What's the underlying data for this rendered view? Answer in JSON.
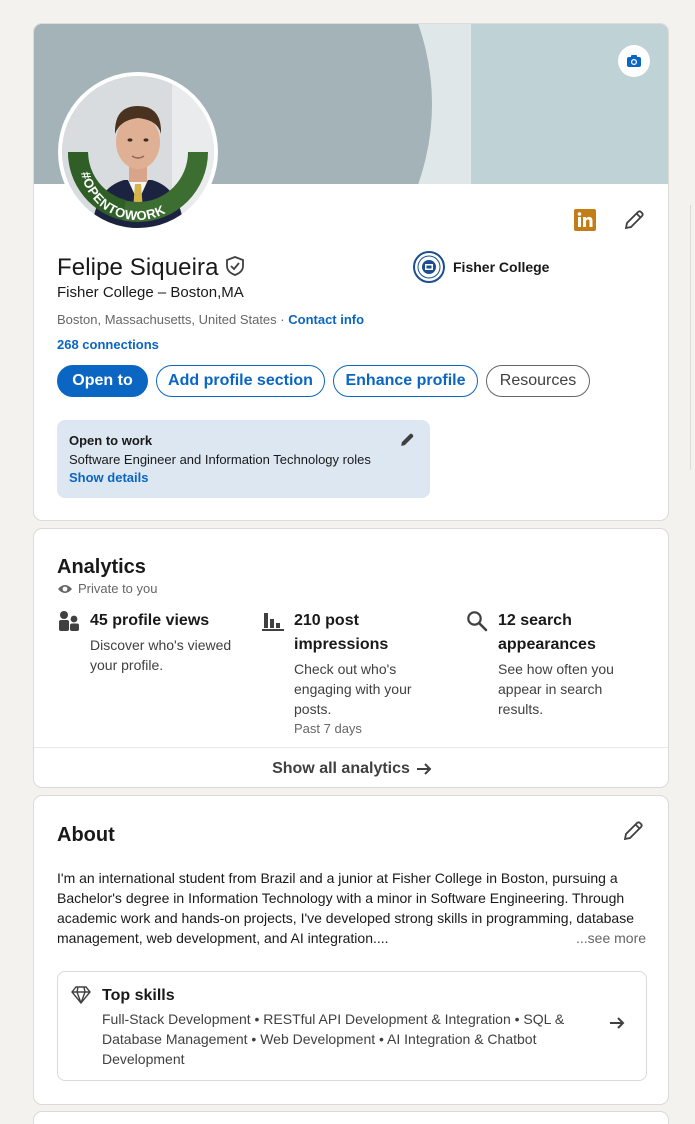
{
  "profile": {
    "name": "Felipe Siqueira",
    "headline": "Fisher College – Boston,MA",
    "location": "Boston, Massachusetts, United States",
    "location_separator": " · ",
    "contact_info_label": "Contact info",
    "connections": "268 connections",
    "avatar_badge_text": "#OPENTOWORK",
    "school": "Fisher College",
    "actions": {
      "open_to": "Open to",
      "add_section": "Add profile section",
      "enhance": "Enhance profile",
      "resources": "Resources"
    },
    "open_to_work": {
      "title": "Open to work",
      "roles": "Software Engineer and Information Technology roles",
      "link": "Show details"
    },
    "colors": {
      "brand_blue": "#0a66c2",
      "open_to_work_green": "#3b6e30",
      "linkedin_badge": "#c37d16"
    }
  },
  "analytics": {
    "title": "Analytics",
    "visibility": "Private to you",
    "metrics": [
      {
        "icon": "people-icon",
        "headline": "45 profile views",
        "description": "Discover who's viewed your profile.",
        "footnote": ""
      },
      {
        "icon": "bar-chart-icon",
        "headline": "210 post impressions",
        "description": "Check out who's engaging with your posts.",
        "footnote": "Past 7 days"
      },
      {
        "icon": "search-icon",
        "headline": "12 search appearances",
        "description": "See how often you appear in search results.",
        "footnote": ""
      }
    ],
    "show_all": "Show all analytics"
  },
  "about": {
    "title": "About",
    "text": "I'm an international student from Brazil and a junior at Fisher College in Boston, pursuing a Bachelor's degree in Information Technology with a minor in Software Engineering. Through academic work and hands-on projects, I've developed strong skills in programming, database management, web development, and AI integration....",
    "see_more": "...see more",
    "top_skills": {
      "title": "Top skills",
      "list": "Full-Stack Development • RESTful API Development & Integration • SQL & Database Management • Web Development • AI Integration & Chatbot Development"
    }
  }
}
